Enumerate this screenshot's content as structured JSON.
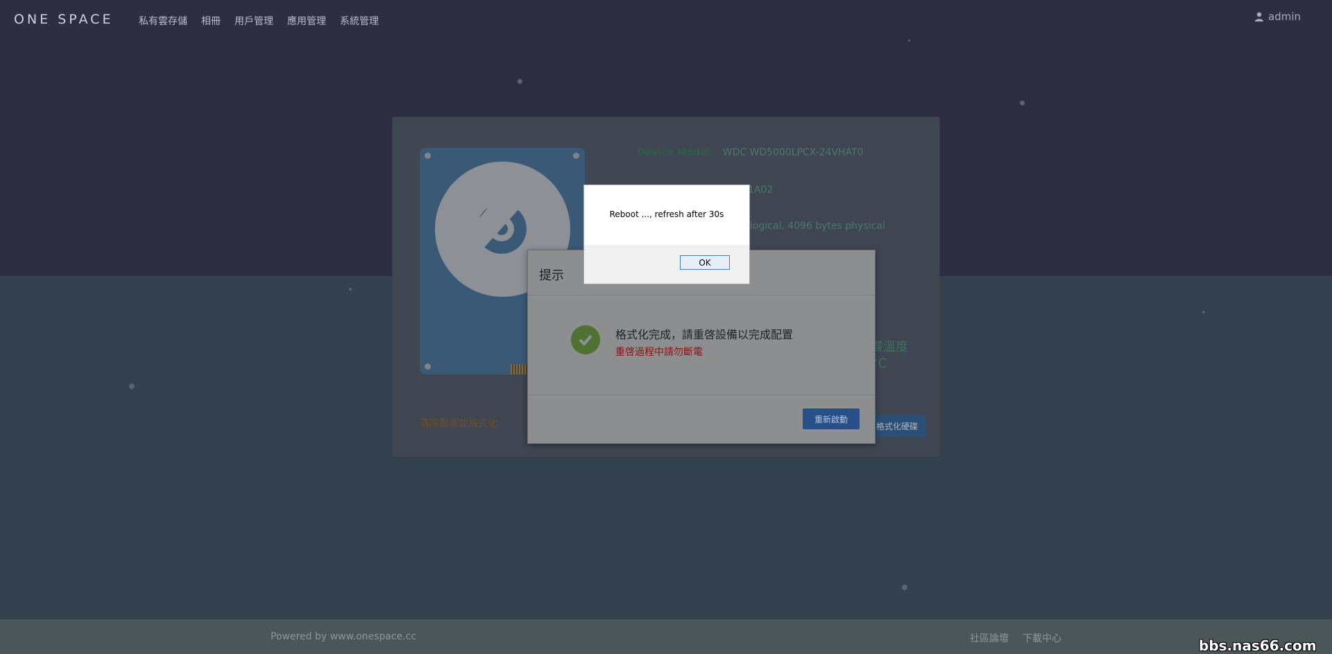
{
  "header": {
    "logo": "ONE SPACE",
    "nav": [
      "私有雲存儲",
      "相冊",
      "用戶管理",
      "應用管理",
      "系統管理"
    ],
    "user": "admin"
  },
  "disk_info": {
    "model_label": "Device Model:",
    "model_value": "WDC WD5000LPCX-24VHAT0",
    "firmware_partial": "1A02",
    "sector_partial": "logical, 4096 bytes physical",
    "temp_label_partial": "碟溫度",
    "temp_value_partial": "°C"
  },
  "card": {
    "format_link": "清除數據並格式化",
    "format_button": "格式化硬碟"
  },
  "modal": {
    "title": "提示",
    "message": "格式化完成，請重啓設備以完成配置",
    "warning": "重啓過程中請勿斷電",
    "reboot_button": "重新啟動"
  },
  "alert": {
    "text": "Reboot ..., refresh after 30s",
    "ok_button": "OK"
  },
  "footer": {
    "powered": "Powered by www.onespace.cc",
    "links": [
      "社區論壇",
      "下載中心"
    ]
  },
  "watermark": "bbs.nas66.com"
}
